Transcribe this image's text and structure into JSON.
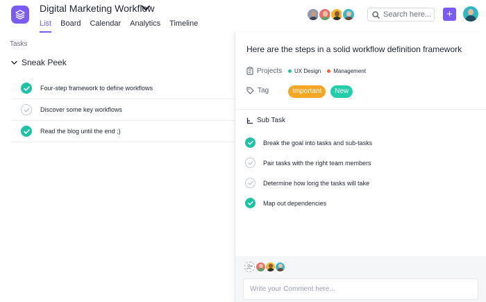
{
  "header": {
    "project_title": "Digital Marketing Workflow",
    "nav": [
      {
        "label": "List",
        "active": true
      },
      {
        "label": "Board",
        "active": false
      },
      {
        "label": "Calendar",
        "active": false
      },
      {
        "label": "Analytics",
        "active": false
      },
      {
        "label": "Timeline",
        "active": false
      }
    ],
    "search_placeholder": "Search here...",
    "add_label": "+",
    "accent_color": "#7b5cf2"
  },
  "left_panel": {
    "tasks_label": "Tasks",
    "section_title": "Sneak Peek",
    "tasks": [
      {
        "text": "Four-step framework to define workflows",
        "done": true
      },
      {
        "text": "Discover some key workflows",
        "done": false
      },
      {
        "text": "Read the blog until the end ;)",
        "done": true
      }
    ]
  },
  "detail": {
    "title": "Here are the steps in a solid workflow definition framework",
    "projects_label": "Projects",
    "projects": [
      {
        "name": "UX Design",
        "color": "#20c2a6"
      },
      {
        "name": "Management",
        "color": "#f2622e"
      }
    ],
    "tag_label": "Tag",
    "tags": [
      {
        "name": "Important",
        "color": "#f5a623"
      },
      {
        "name": "New",
        "color": "#23cfa9"
      }
    ],
    "subtask_label": "Sub Task",
    "subtasks": [
      {
        "text": "Break the goal into tasks and sub-tasks",
        "done": true
      },
      {
        "text": "Pair tasks with the right team members",
        "done": false
      },
      {
        "text": "Determine how long the tasks will take",
        "done": false
      },
      {
        "text": "Map out dependencies",
        "done": true
      }
    ],
    "comment_placeholder": "Write your Comment here...",
    "done_color": "#20c2a6"
  }
}
